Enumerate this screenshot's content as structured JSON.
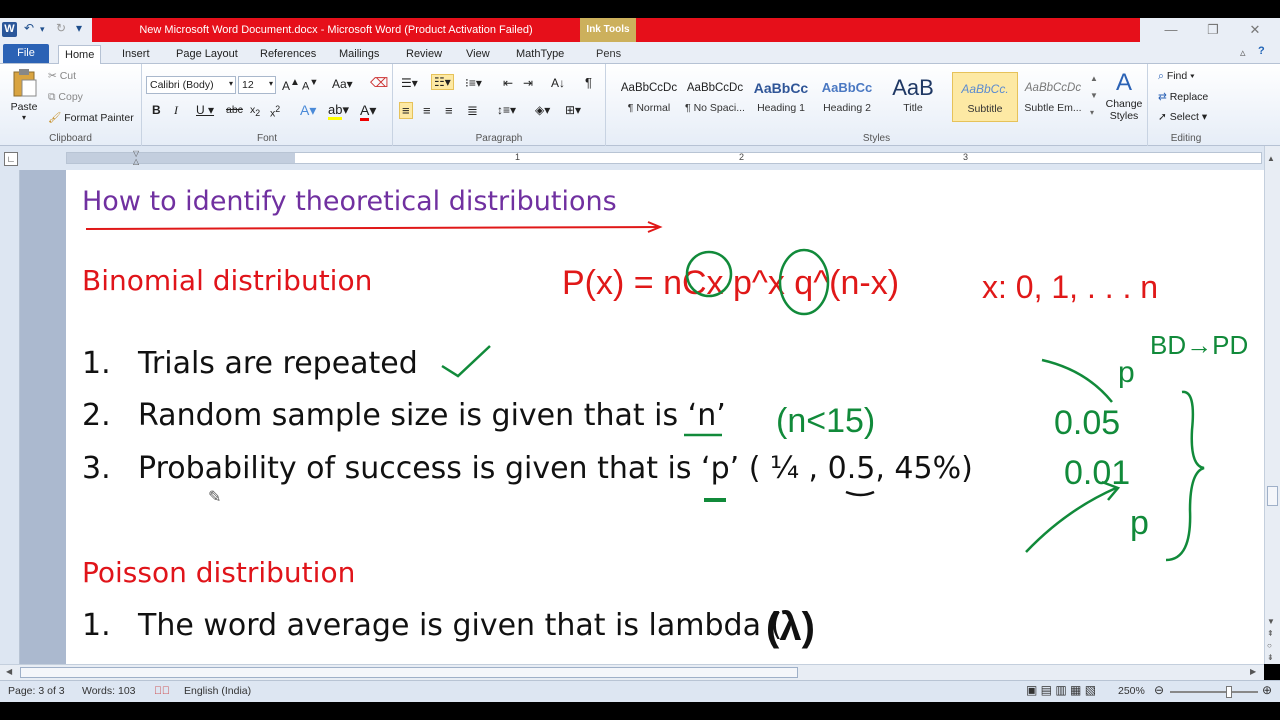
{
  "window": {
    "title": "New Microsoft Word Document.docx  -  Microsoft Word (Product Activation Failed)",
    "contextual_tab_group": "Ink Tools"
  },
  "tabs": [
    "File",
    "Home",
    "Insert",
    "Page Layout",
    "References",
    "Mailings",
    "Review",
    "View",
    "MathType",
    "Pens"
  ],
  "ribbon": {
    "clipboard": {
      "paste": "Paste",
      "cut": "Cut",
      "copy": "Copy",
      "format_painter": "Format Painter",
      "label": "Clipboard"
    },
    "font": {
      "font_name": "Calibri (Body)",
      "font_size": "12",
      "label": "Font"
    },
    "paragraph": {
      "label": "Paragraph"
    },
    "styles": {
      "items": [
        {
          "preview": "AaBbCcDc",
          "name": "¶ Normal"
        },
        {
          "preview": "AaBbCcDc",
          "name": "¶ No Spaci..."
        },
        {
          "preview": "AaBbCc",
          "name": "Heading 1"
        },
        {
          "preview": "AaBbCc",
          "name": "Heading 2"
        },
        {
          "preview": "AaB",
          "name": "Title"
        },
        {
          "preview": "AaBbCc.",
          "name": "Subtitle"
        },
        {
          "preview": "AaBbCcDc",
          "name": "Subtle Em..."
        }
      ],
      "change_styles": "Change Styles",
      "label": "Styles"
    },
    "editing": {
      "find": "Find",
      "replace": "Replace",
      "select": "Select",
      "label": "Editing"
    }
  },
  "ruler": {
    "numbers": [
      "1",
      "2",
      "3"
    ]
  },
  "document": {
    "heading": "How to identify theoretical distributions",
    "binomial": {
      "title": "Binomial distribution",
      "items": [
        {
          "num": "1.",
          "text": "Trials are repeated"
        },
        {
          "num": "2.",
          "text": "Random sample size is given that is ‘n’"
        },
        {
          "num": "3.",
          "text": "Probability of success is given that is ‘p’ ( ¼ , 0.5, 45%)"
        }
      ]
    },
    "poisson": {
      "title": "Poisson distribution",
      "items": [
        {
          "num": "1.",
          "text": "The word average is given that is lambda ("
        }
      ]
    },
    "annotations": {
      "formula": "P(x) = nCx p^x q^(n-x)",
      "range": "x: 0, 1, . . . n",
      "condition": "(n<15)",
      "bd_pd": "BD→PD",
      "p_label": "p",
      "p_values": [
        "0.05",
        "0.01"
      ],
      "p_bottom": "p",
      "lambda": "(λ)"
    }
  },
  "status": {
    "page": "Page: 3 of 3",
    "words": "Words: 103",
    "language": "English (India)",
    "zoom": "250%"
  }
}
